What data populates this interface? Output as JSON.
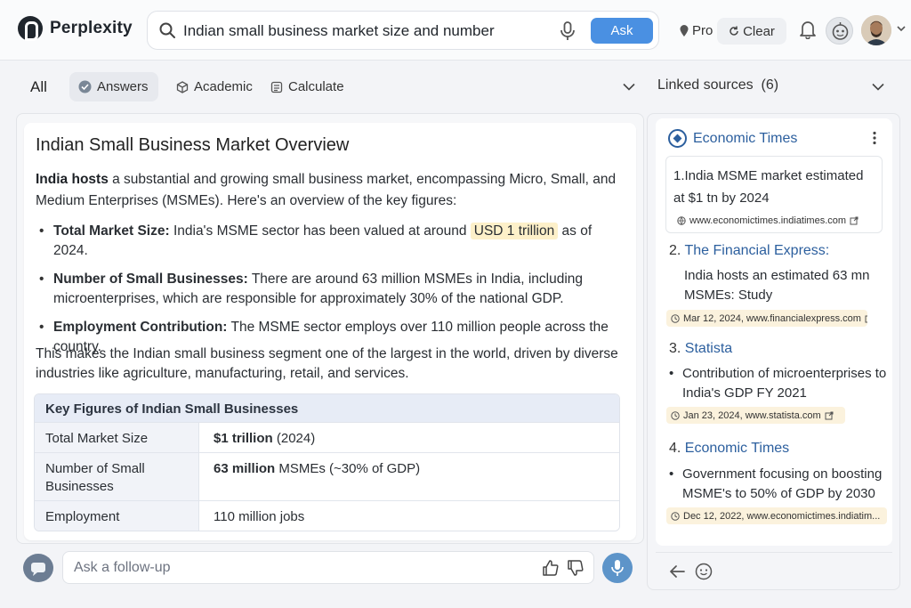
{
  "app": {
    "name": "Perplexity"
  },
  "search": {
    "query": "Indian small business market size and number",
    "ask_label": "Ask"
  },
  "header": {
    "pro_label": "Pro",
    "clear_label": "Clear"
  },
  "tabs": {
    "all": "All",
    "answers": "Answers",
    "academic": "Academic",
    "calculate": "Calculate"
  },
  "sources": {
    "header_label": "Linked sources",
    "header_count": "(6)",
    "items": [
      {
        "source_name": "Economic Times",
        "number": "1.",
        "title": "India MSME market estimated at $1 tn by 2024",
        "meta": "www.economictimes.indiatimes.com"
      },
      {
        "number": "2.",
        "source_name": "The Financial Express:",
        "text": "India hosts an estimated 63 mn MSMEs: Study",
        "meta": "Mar 12, 2024, www.financialexpress.com"
      },
      {
        "number": "3.",
        "source_name": "Statista",
        "text": "Contribution of microenterprises to India's GDP FY 2021",
        "meta": "Jan 23, 2024, www.statista.com"
      },
      {
        "number": "4.",
        "source_name": "Economic Times",
        "text": "Government focusing on boosting MSME's to 50% of GDP by 2030",
        "meta": "Dec 12, 2022, www.economictimes.indiatim..."
      }
    ]
  },
  "answer": {
    "title": "Indian Small Business Market Overview",
    "intro_bold": "India hosts",
    "intro_rest": " a substantial and growing small business market, encompassing Micro, Small, and Medium Enterprises (MSMEs). Here's an overview of the key figures:",
    "bullets": [
      {
        "label": "Total Market Size:",
        "pre": " India's MSME sector has been valued at around ",
        "highlight": "USD 1 trillion",
        "post": " as of 2024."
      },
      {
        "label": "Number of Small Businesses:",
        "text": " There are around 63 million MSMEs in India, including microenterprises, which are responsible for approximately 30% of the national GDP."
      },
      {
        "label": "Employment Contribution:",
        "text": " The MSME sector employs over 110 million people across the country."
      }
    ],
    "outro": "This makes the Indian small business segment one of the largest in the world, driven by diverse industries like agriculture, manufacturing, retail, and services.",
    "table": {
      "caption": "Key Figures of Indian Small Businesses",
      "rows": [
        {
          "key": "Total Market Size",
          "value_bold": "$1 trillion",
          "value_rest": " (2024)"
        },
        {
          "key": "Number of Small Businesses",
          "value_bold": "63 million",
          "value_rest": " MSMEs (~30% of GDP)"
        },
        {
          "key": "Employment",
          "value_bold": "",
          "value_rest": "110 million jobs"
        }
      ]
    }
  },
  "followup": {
    "placeholder": "Ask a follow-up"
  },
  "colors": {
    "accent": "#4a90e2",
    "link": "#2c5f9e",
    "highlight": "#fdf0c9"
  }
}
